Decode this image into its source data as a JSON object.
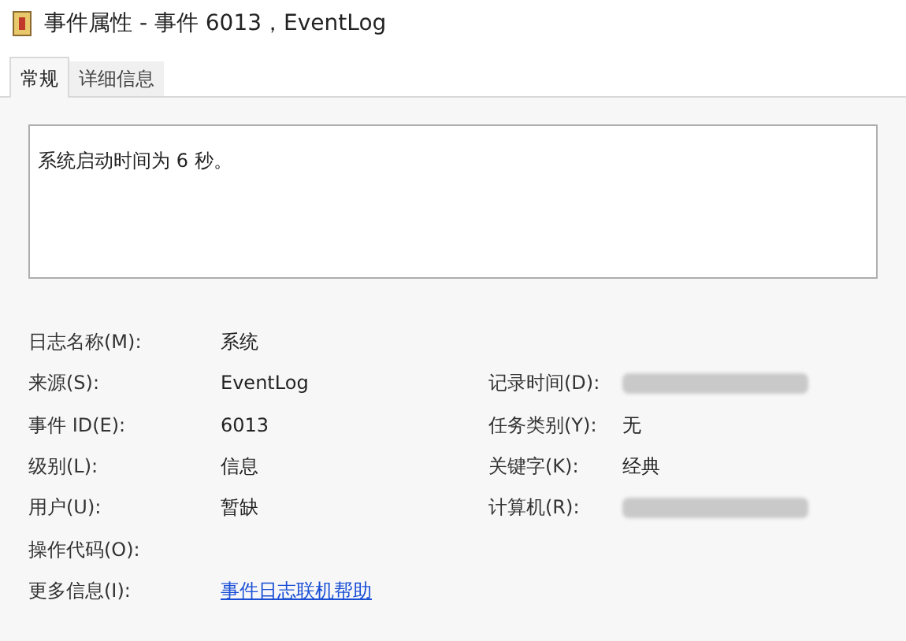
{
  "window": {
    "title": "事件属性 - 事件 6013，EventLog"
  },
  "tabs": [
    {
      "label": "常规",
      "selected": true
    },
    {
      "label": "详细信息",
      "selected": false
    }
  ],
  "message": "系统启动时间为 6 秒。",
  "fields": [
    {
      "label": "日志名称(M):",
      "value": "系统"
    },
    {
      "label": "来源(S):",
      "value": "EventLog",
      "right": {
        "kind": "redacted",
        "label": "记录时间(D):"
      }
    },
    {
      "label": "事件 ID(E):",
      "value": "6013",
      "right": {
        "kind": "text",
        "label": "任务类别(Y):",
        "value": "无"
      }
    },
    {
      "label": "级别(L):",
      "value": "信息",
      "right": {
        "kind": "text",
        "label": "关键字(K):",
        "value": "经典"
      }
    },
    {
      "label": "用户(U):",
      "value": "暂缺",
      "right": {
        "kind": "redacted",
        "label": "计算机(R):"
      }
    },
    {
      "label": "操作代码(O):"
    },
    {
      "label": "更多信息(I):",
      "link": "事件日志联机帮助"
    }
  ]
}
